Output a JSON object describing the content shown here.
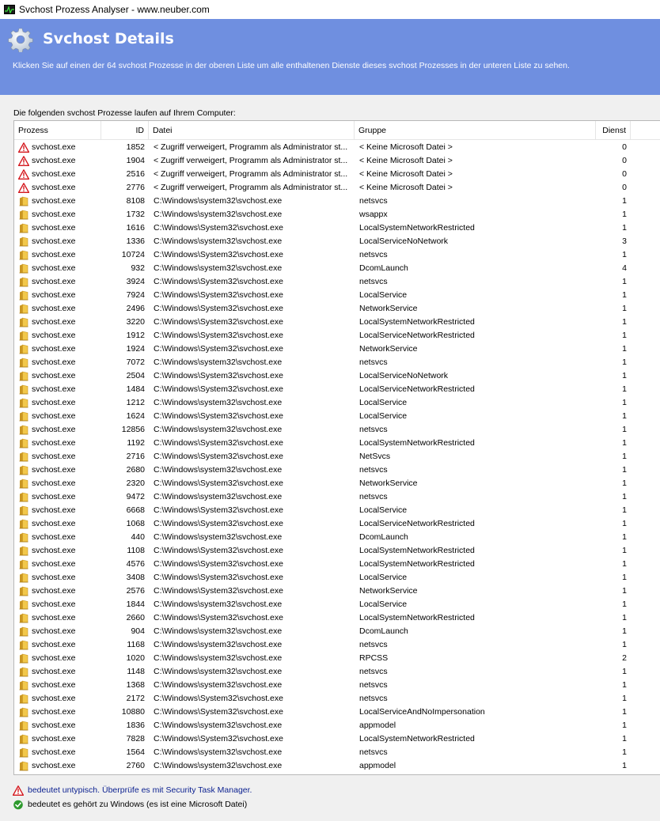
{
  "window": {
    "title": "Svchost Prozess Analyser - www.neuber.com"
  },
  "banner": {
    "heading": "Svchost Details",
    "description": "Klicken Sie auf einen der 64 svchost Prozesse in der oberen Liste um alle enthaltenen Dienste dieses svchost Prozesses in der unteren Liste zu sehen."
  },
  "list": {
    "caption": "Die folgenden svchost Prozesse laufen auf Ihrem Computer:",
    "columns": {
      "process": "Prozess",
      "id": "ID",
      "file": "Datei",
      "group": "Gruppe",
      "service": "Dienst"
    },
    "rows": [
      {
        "icon": "warning",
        "process": "svchost.exe",
        "id": "1852",
        "file": "< Zugriff verweigert, Programm als Administrator st...",
        "group": "< Keine Microsoft Datei >",
        "service": "0"
      },
      {
        "icon": "warning",
        "process": "svchost.exe",
        "id": "1904",
        "file": "< Zugriff verweigert, Programm als Administrator st...",
        "group": "< Keine Microsoft Datei >",
        "service": "0"
      },
      {
        "icon": "warning",
        "process": "svchost.exe",
        "id": "2516",
        "file": "< Zugriff verweigert, Programm als Administrator st...",
        "group": "< Keine Microsoft Datei >",
        "service": "0"
      },
      {
        "icon": "warning",
        "process": "svchost.exe",
        "id": "2776",
        "file": "< Zugriff verweigert, Programm als Administrator st...",
        "group": "< Keine Microsoft Datei >",
        "service": "0"
      },
      {
        "icon": "folder",
        "process": "svchost.exe",
        "id": "8108",
        "file": "C:\\Windows\\system32\\svchost.exe",
        "group": "netsvcs",
        "service": "1"
      },
      {
        "icon": "folder",
        "process": "svchost.exe",
        "id": "1732",
        "file": "C:\\Windows\\system32\\svchost.exe",
        "group": "wsappx",
        "service": "1"
      },
      {
        "icon": "folder",
        "process": "svchost.exe",
        "id": "1616",
        "file": "C:\\Windows\\System32\\svchost.exe",
        "group": "LocalSystemNetworkRestricted",
        "service": "1"
      },
      {
        "icon": "folder",
        "process": "svchost.exe",
        "id": "1336",
        "file": "C:\\Windows\\system32\\svchost.exe",
        "group": "LocalServiceNoNetwork",
        "service": "3"
      },
      {
        "icon": "folder",
        "process": "svchost.exe",
        "id": "10724",
        "file": "C:\\Windows\\System32\\svchost.exe",
        "group": "netsvcs",
        "service": "1"
      },
      {
        "icon": "folder",
        "process": "svchost.exe",
        "id": "932",
        "file": "C:\\Windows\\system32\\svchost.exe",
        "group": "DcomLaunch",
        "service": "4"
      },
      {
        "icon": "folder",
        "process": "svchost.exe",
        "id": "3924",
        "file": "C:\\Windows\\System32\\svchost.exe",
        "group": "netsvcs",
        "service": "1"
      },
      {
        "icon": "folder",
        "process": "svchost.exe",
        "id": "7924",
        "file": "C:\\Windows\\System32\\svchost.exe",
        "group": "LocalService",
        "service": "1"
      },
      {
        "icon": "folder",
        "process": "svchost.exe",
        "id": "2496",
        "file": "C:\\Windows\\System32\\svchost.exe",
        "group": "NetworkService",
        "service": "1"
      },
      {
        "icon": "folder",
        "process": "svchost.exe",
        "id": "3220",
        "file": "C:\\Windows\\System32\\svchost.exe",
        "group": "LocalSystemNetworkRestricted",
        "service": "1"
      },
      {
        "icon": "folder",
        "process": "svchost.exe",
        "id": "1912",
        "file": "C:\\Windows\\System32\\svchost.exe",
        "group": "LocalServiceNetworkRestricted",
        "service": "1"
      },
      {
        "icon": "folder",
        "process": "svchost.exe",
        "id": "1924",
        "file": "C:\\Windows\\System32\\svchost.exe",
        "group": "NetworkService",
        "service": "1"
      },
      {
        "icon": "folder",
        "process": "svchost.exe",
        "id": "7072",
        "file": "C:\\Windows\\system32\\svchost.exe",
        "group": "netsvcs",
        "service": "1"
      },
      {
        "icon": "folder",
        "process": "svchost.exe",
        "id": "2504",
        "file": "C:\\Windows\\System32\\svchost.exe",
        "group": "LocalServiceNoNetwork",
        "service": "1"
      },
      {
        "icon": "folder",
        "process": "svchost.exe",
        "id": "1484",
        "file": "C:\\Windows\\System32\\svchost.exe",
        "group": "LocalServiceNetworkRestricted",
        "service": "1"
      },
      {
        "icon": "folder",
        "process": "svchost.exe",
        "id": "1212",
        "file": "C:\\Windows\\system32\\svchost.exe",
        "group": "LocalService",
        "service": "1"
      },
      {
        "icon": "folder",
        "process": "svchost.exe",
        "id": "1624",
        "file": "C:\\Windows\\System32\\svchost.exe",
        "group": "LocalService",
        "service": "1"
      },
      {
        "icon": "folder",
        "process": "svchost.exe",
        "id": "12856",
        "file": "C:\\Windows\\system32\\svchost.exe",
        "group": "netsvcs",
        "service": "1"
      },
      {
        "icon": "folder",
        "process": "svchost.exe",
        "id": "1192",
        "file": "C:\\Windows\\System32\\svchost.exe",
        "group": "LocalSystemNetworkRestricted",
        "service": "1"
      },
      {
        "icon": "folder",
        "process": "svchost.exe",
        "id": "2716",
        "file": "C:\\Windows\\System32\\svchost.exe",
        "group": "NetSvcs",
        "service": "1"
      },
      {
        "icon": "folder",
        "process": "svchost.exe",
        "id": "2680",
        "file": "C:\\Windows\\system32\\svchost.exe",
        "group": "netsvcs",
        "service": "1"
      },
      {
        "icon": "folder",
        "process": "svchost.exe",
        "id": "2320",
        "file": "C:\\Windows\\System32\\svchost.exe",
        "group": "NetworkService",
        "service": "1"
      },
      {
        "icon": "folder",
        "process": "svchost.exe",
        "id": "9472",
        "file": "C:\\Windows\\system32\\svchost.exe",
        "group": "netsvcs",
        "service": "1"
      },
      {
        "icon": "folder",
        "process": "svchost.exe",
        "id": "6668",
        "file": "C:\\Windows\\System32\\svchost.exe",
        "group": "LocalService",
        "service": "1"
      },
      {
        "icon": "folder",
        "process": "svchost.exe",
        "id": "1068",
        "file": "C:\\Windows\\System32\\svchost.exe",
        "group": "LocalServiceNetworkRestricted",
        "service": "1"
      },
      {
        "icon": "folder",
        "process": "svchost.exe",
        "id": "440",
        "file": "C:\\Windows\\system32\\svchost.exe",
        "group": "DcomLaunch",
        "service": "1"
      },
      {
        "icon": "folder",
        "process": "svchost.exe",
        "id": "1108",
        "file": "C:\\Windows\\System32\\svchost.exe",
        "group": "LocalSystemNetworkRestricted",
        "service": "1"
      },
      {
        "icon": "folder",
        "process": "svchost.exe",
        "id": "4576",
        "file": "C:\\Windows\\System32\\svchost.exe",
        "group": "LocalSystemNetworkRestricted",
        "service": "1"
      },
      {
        "icon": "folder",
        "process": "svchost.exe",
        "id": "3408",
        "file": "C:\\Windows\\System32\\svchost.exe",
        "group": "LocalService",
        "service": "1"
      },
      {
        "icon": "folder",
        "process": "svchost.exe",
        "id": "2576",
        "file": "C:\\Windows\\System32\\svchost.exe",
        "group": "NetworkService",
        "service": "1"
      },
      {
        "icon": "folder",
        "process": "svchost.exe",
        "id": "1844",
        "file": "C:\\Windows\\system32\\svchost.exe",
        "group": "LocalService",
        "service": "1"
      },
      {
        "icon": "folder",
        "process": "svchost.exe",
        "id": "2660",
        "file": "C:\\Windows\\System32\\svchost.exe",
        "group": "LocalSystemNetworkRestricted",
        "service": "1"
      },
      {
        "icon": "folder",
        "process": "svchost.exe",
        "id": "904",
        "file": "C:\\Windows\\system32\\svchost.exe",
        "group": "DcomLaunch",
        "service": "1"
      },
      {
        "icon": "folder",
        "process": "svchost.exe",
        "id": "1168",
        "file": "C:\\Windows\\system32\\svchost.exe",
        "group": "netsvcs",
        "service": "1"
      },
      {
        "icon": "folder",
        "process": "svchost.exe",
        "id": "1020",
        "file": "C:\\Windows\\system32\\svchost.exe",
        "group": "RPCSS",
        "service": "2"
      },
      {
        "icon": "folder",
        "process": "svchost.exe",
        "id": "1148",
        "file": "C:\\Windows\\system32\\svchost.exe",
        "group": "netsvcs",
        "service": "1"
      },
      {
        "icon": "folder",
        "process": "svchost.exe",
        "id": "1368",
        "file": "C:\\Windows\\system32\\svchost.exe",
        "group": "netsvcs",
        "service": "1"
      },
      {
        "icon": "folder",
        "process": "svchost.exe",
        "id": "2172",
        "file": "C:\\Windows\\System32\\svchost.exe",
        "group": "netsvcs",
        "service": "1"
      },
      {
        "icon": "folder",
        "process": "svchost.exe",
        "id": "10880",
        "file": "C:\\Windows\\System32\\svchost.exe",
        "group": "LocalServiceAndNoImpersonation",
        "service": "1"
      },
      {
        "icon": "folder",
        "process": "svchost.exe",
        "id": "1836",
        "file": "C:\\Windows\\system32\\svchost.exe",
        "group": "appmodel",
        "service": "1"
      },
      {
        "icon": "folder",
        "process": "svchost.exe",
        "id": "7828",
        "file": "C:\\Windows\\System32\\svchost.exe",
        "group": "LocalSystemNetworkRestricted",
        "service": "1"
      },
      {
        "icon": "folder",
        "process": "svchost.exe",
        "id": "1564",
        "file": "C:\\Windows\\system32\\svchost.exe",
        "group": "netsvcs",
        "service": "1"
      },
      {
        "icon": "folder",
        "process": "svchost.exe",
        "id": "2760",
        "file": "C:\\Windows\\system32\\svchost.exe",
        "group": "appmodel",
        "service": "1"
      },
      {
        "icon": "folder",
        "process": "",
        "id": "",
        "file": "",
        "group": "",
        "service": ""
      }
    ]
  },
  "legend": {
    "warning_text": "bedeutet untypisch. Überprüfe es mit Security Task Manager.",
    "ok_text": "bedeutet es gehört zu Windows (es ist eine Microsoft Datei)"
  },
  "colors": {
    "banner": "#6f8fe0",
    "warning_red": "#d4161c",
    "folder_yellow": "#e8b93a",
    "ok_green": "#2e9a2e"
  }
}
